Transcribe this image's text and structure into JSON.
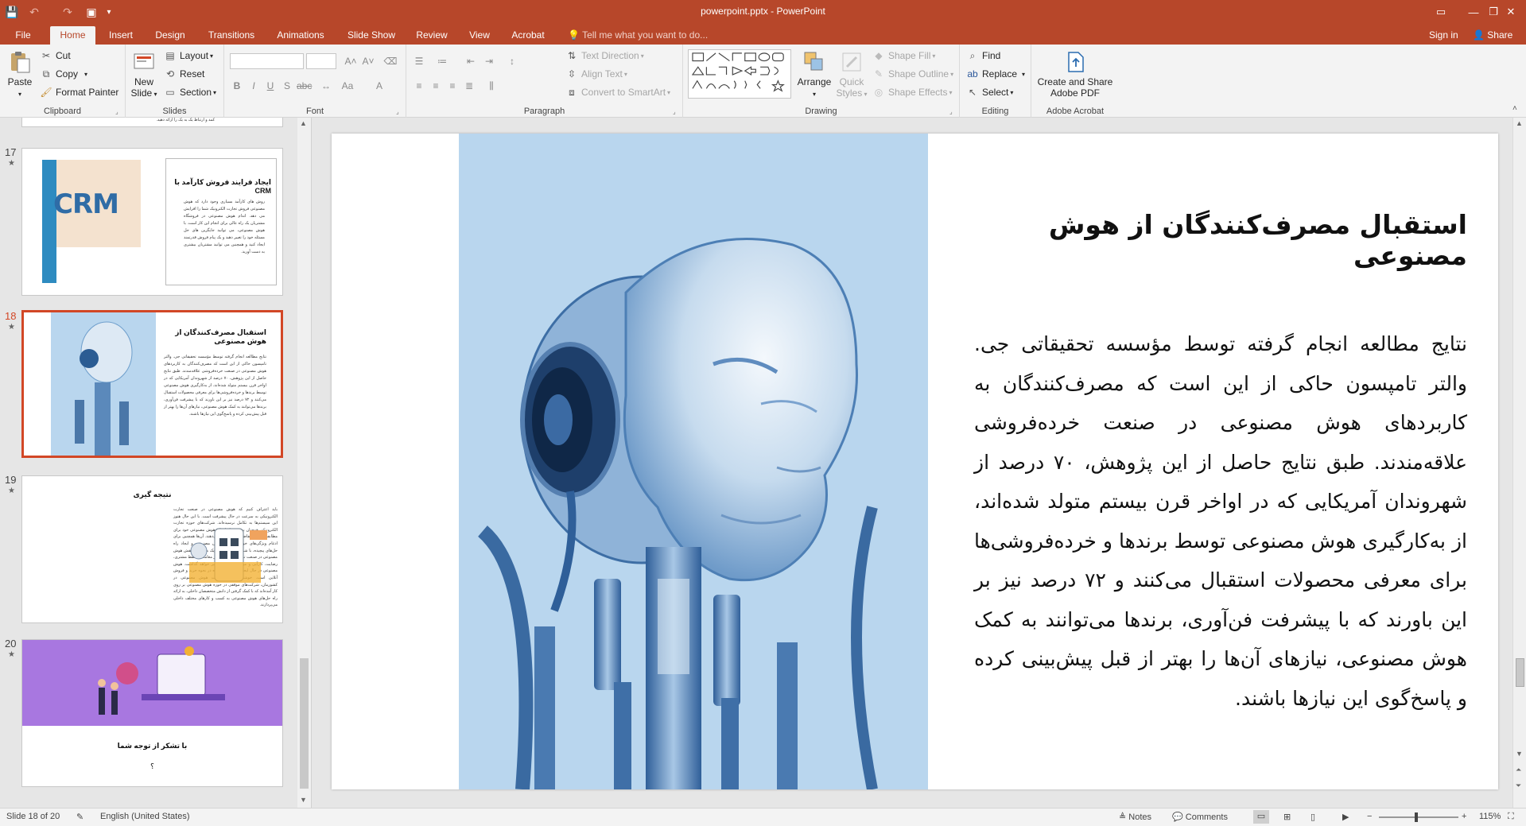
{
  "window": {
    "title": "powerpoint.pptx - PowerPoint",
    "controls": {
      "ribbon_options": "▭",
      "minimize": "—",
      "restore": "❐",
      "close": "✕"
    }
  },
  "qat": {
    "save": "💾",
    "undo": "↶",
    "redo": "↷",
    "start": "▣",
    "more": "▾"
  },
  "tabs": [
    {
      "label": "File"
    },
    {
      "label": "Home"
    },
    {
      "label": "Insert"
    },
    {
      "label": "Design"
    },
    {
      "label": "Transitions"
    },
    {
      "label": "Animations"
    },
    {
      "label": "Slide Show"
    },
    {
      "label": "Review"
    },
    {
      "label": "View"
    },
    {
      "label": "Acrobat"
    }
  ],
  "tellme": "Tell me what you want to do...",
  "signin": "Sign in",
  "share": "Share",
  "ribbon": {
    "clipboard": {
      "label": "Clipboard",
      "paste": "Paste",
      "cut": "Cut",
      "copy": "Copy",
      "format_painter": "Format Painter"
    },
    "slides": {
      "label": "Slides",
      "new_slide_1": "New",
      "new_slide_2": "Slide",
      "layout": "Layout",
      "reset": "Reset",
      "section": "Section"
    },
    "font": {
      "label": "Font"
    },
    "paragraph": {
      "label": "Paragraph",
      "text_direction": "Text Direction",
      "align_text": "Align Text",
      "convert_smartart": "Convert to SmartArt"
    },
    "drawing": {
      "label": "Drawing",
      "arrange": "Arrange",
      "quick_styles_1": "Quick",
      "quick_styles_2": "Styles",
      "shape_fill": "Shape Fill",
      "shape_outline": "Shape Outline",
      "shape_effects": "Shape Effects"
    },
    "editing": {
      "label": "Editing",
      "find": "Find",
      "replace": "Replace",
      "select": "Select"
    },
    "acrobat": {
      "label": "Adobe Acrobat",
      "create_1": "Create and Share",
      "create_2": "Adobe PDF"
    }
  },
  "thumbnails": {
    "top_partial_text": "کمد و ارتباط یک به یک را ارائه دهید.",
    "items": [
      {
        "number": "17",
        "title": "ایجاد فرایند فروش کارآمد با CRM",
        "body": "روش های کارآمد بسیاری وجود دارد که هوش مصنوعی فروش تجارت الکترونیک شما را افزایش می دهد. اندام هوش مصنوعی در فروشگاه مشتریان یک راه عالی برای انجام این کار است. با هوش مصنوعی، می توانید جایگزین های حل مسئله خود را تغییر دهید و یک پیام فروش قدرتمند ایجاد کنید و همچنین می توانید مشتریان بیشتری به دست آورید.",
        "image_label": "CRM"
      },
      {
        "number": "18",
        "title": "استقبال مصرف‌کنندگان از هوش مصنوعی",
        "body": "نتایج مطالعه انجام گرفته توسط مؤسسه تحقیقاتی جی. والتر تامپسون حاکی از این است که مصرف‌کنندگان به کاربردهای هوش مصنوعی در صنعت خرده‌فروشی علاقه‌مندند. طبق نتایج حاصل از این پژوهش، ۷۰ درصد از شهروندان آمریکایی که در اواخر قرن بیستم متولد شده‌اند، از به‌کارگیری هوش مصنوعی توسط برندها و خرده‌فروشی‌ها برای معرفی محصولات استقبال می‌کنند و ۷۲ درصد نیز بر این باورند که با پیشرفت فن‌آوری، برندها می‌توانند به کمک هوش مصنوعی، نیازهای آن‌ها را بهتر از قبل پیش‌بینی کرده و پاسخ‌گوی این نیازها باشند."
      },
      {
        "number": "19",
        "title": "نتیجه گیری",
        "body": "باید اعتراف کنیم که هوش مصنوعی در صنعت تجارت الکترونیکی به سرعت در حال پیشرفت است. با این حال هنوز این سیستم‌ها به تکامل نرسیده‌اند. شرکت‌های حوزه تجارت الکترونیکی همچنان به بهبود ابزارهای هوش مصنوعی خود برای مطابقت بهتر با تقاضای بازار ادامه می‌دهند. آن‌ها همچنین برای ادغام ویژگی‌های خود در زمینه هوش مصنوعی و ایجاد راه حل‌های پیچیده، با شرکت‌های دیگر شریک می‌شوند. نقش هوش مصنوعی در صنعت تجارت الکترونیک بر معاملات، حفظ مشتری، رضایت، کارآیی و موارد مهم دیگر تأثیر خواهد گذاشت. هوش مصنوعی در حال ایجاد تغییرات گسترده در نحوه خرید و فروش آنلاین است. خوشبختانه با پیشرفت هوش مصنوعی در کشورمان، شرکت‌های موفقی در حوزه هوش مصنوعی بر روی کار آمده‌اند که با کمک گرفتن از دانش متخصصان داخلی، به ارائه راه حل‌های هوش مصنوعی به کسب و کارهای مختلف داخلی می‌پردازند."
      },
      {
        "number": "20",
        "title": "با تشکر از توجه شما",
        "body": "؟"
      }
    ]
  },
  "slide": {
    "title": "استقبال مصرف‌کنندگان از هوش مصنوعی",
    "body": "نتایج مطالعه انجام گرفته توسط مؤسسه تحقیقاتی جی. والتر تامپسون حاکی از این است که مصرف‌کنندگان به کاربردهای هوش مصنوعی در صنعت خرده‌فروشی علاقه‌مندند. طبق نتایج حاصل از این پژوهش، ۷۰ درصد از شهروندان آمریکایی که در اواخر قرن بیستم متولد شده‌اند، از به‌کارگیری هوش مصنوعی توسط برندها و خرده‌فروشی‌ها برای معرفی محصولات استقبال می‌کنند و ۷۲ درصد نیز بر این باورند که با پیشرفت فن‌آوری، برندها می‌توانند به کمک هوش مصنوعی، نیازهای آن‌ها را بهتر از قبل پیش‌بینی کرده و پاسخ‌گوی این نیازها باشند."
  },
  "status": {
    "slide_count": "Slide 18 of 20",
    "language": "English (United States)",
    "notes": "Notes",
    "comments": "Comments",
    "zoom": "115%"
  },
  "colors": {
    "accent": "#b7472a",
    "selected_border": "#d24726",
    "robot_bg": "#b9d6ee"
  }
}
